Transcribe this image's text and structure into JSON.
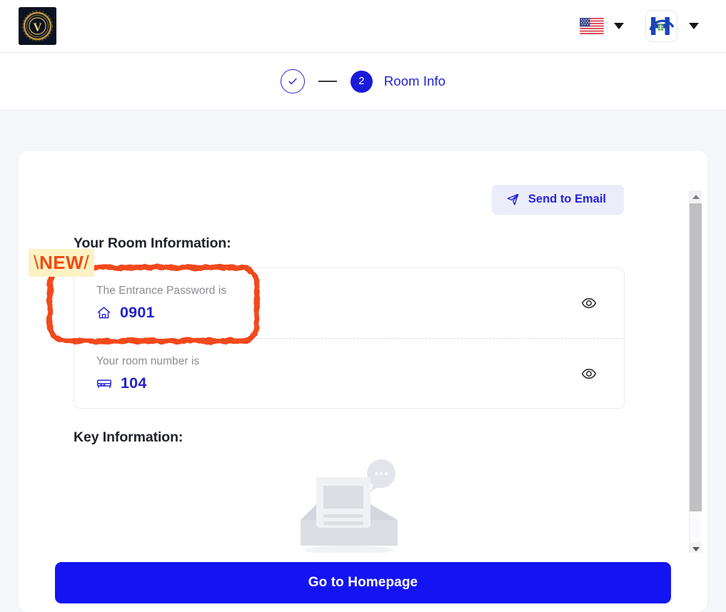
{
  "header": {
    "brand_logo_name": "vermont-crest-logo",
    "brand_logo_letter": "V",
    "language": {
      "icon": "us-flag-icon",
      "caret": "chevron-down-icon"
    },
    "property": {
      "icon": "h-house-logo-icon",
      "caret": "chevron-down-icon"
    }
  },
  "stepper": {
    "step1": {
      "icon": "check-icon",
      "state": "completed"
    },
    "step2": {
      "number": "2",
      "label": "Room Info",
      "state": "current"
    }
  },
  "main": {
    "send_email_button": {
      "label": "Send to Email",
      "icon": "send-plane-icon"
    },
    "room_information_title": "Your Room Information:",
    "rows": [
      {
        "label": "The Entrance Password is",
        "icon": "home-icon",
        "value": "0901",
        "toggle_icon": "eye-icon"
      },
      {
        "label": "Your room number is",
        "icon": "bed-icon",
        "value": "104",
        "toggle_icon": "eye-icon"
      }
    ],
    "key_information_title": "Key Information:",
    "empty_state": {
      "icon": "empty-inbox-illustration"
    }
  },
  "cta": {
    "label": "Go to Homepage"
  },
  "annotations": {
    "new_badge": {
      "text": "NEW",
      "left_slash": "\\",
      "right_slash": "/"
    },
    "highlight_box": {
      "target": "entrance-password-row",
      "color": "#f2481c"
    }
  },
  "scrollbar": {
    "up_arrow": "scroll-up-arrow",
    "down_arrow": "scroll-down-arrow",
    "thumb": "scroll-thumb"
  },
  "colors": {
    "page_bg": "#f5f6fa",
    "primary_blue": "#1414f3",
    "accent_blue": "#2222cc",
    "badge_bg": "#fcf2c4",
    "badge_text": "#f14a12",
    "annotation_red": "#f2481c"
  }
}
